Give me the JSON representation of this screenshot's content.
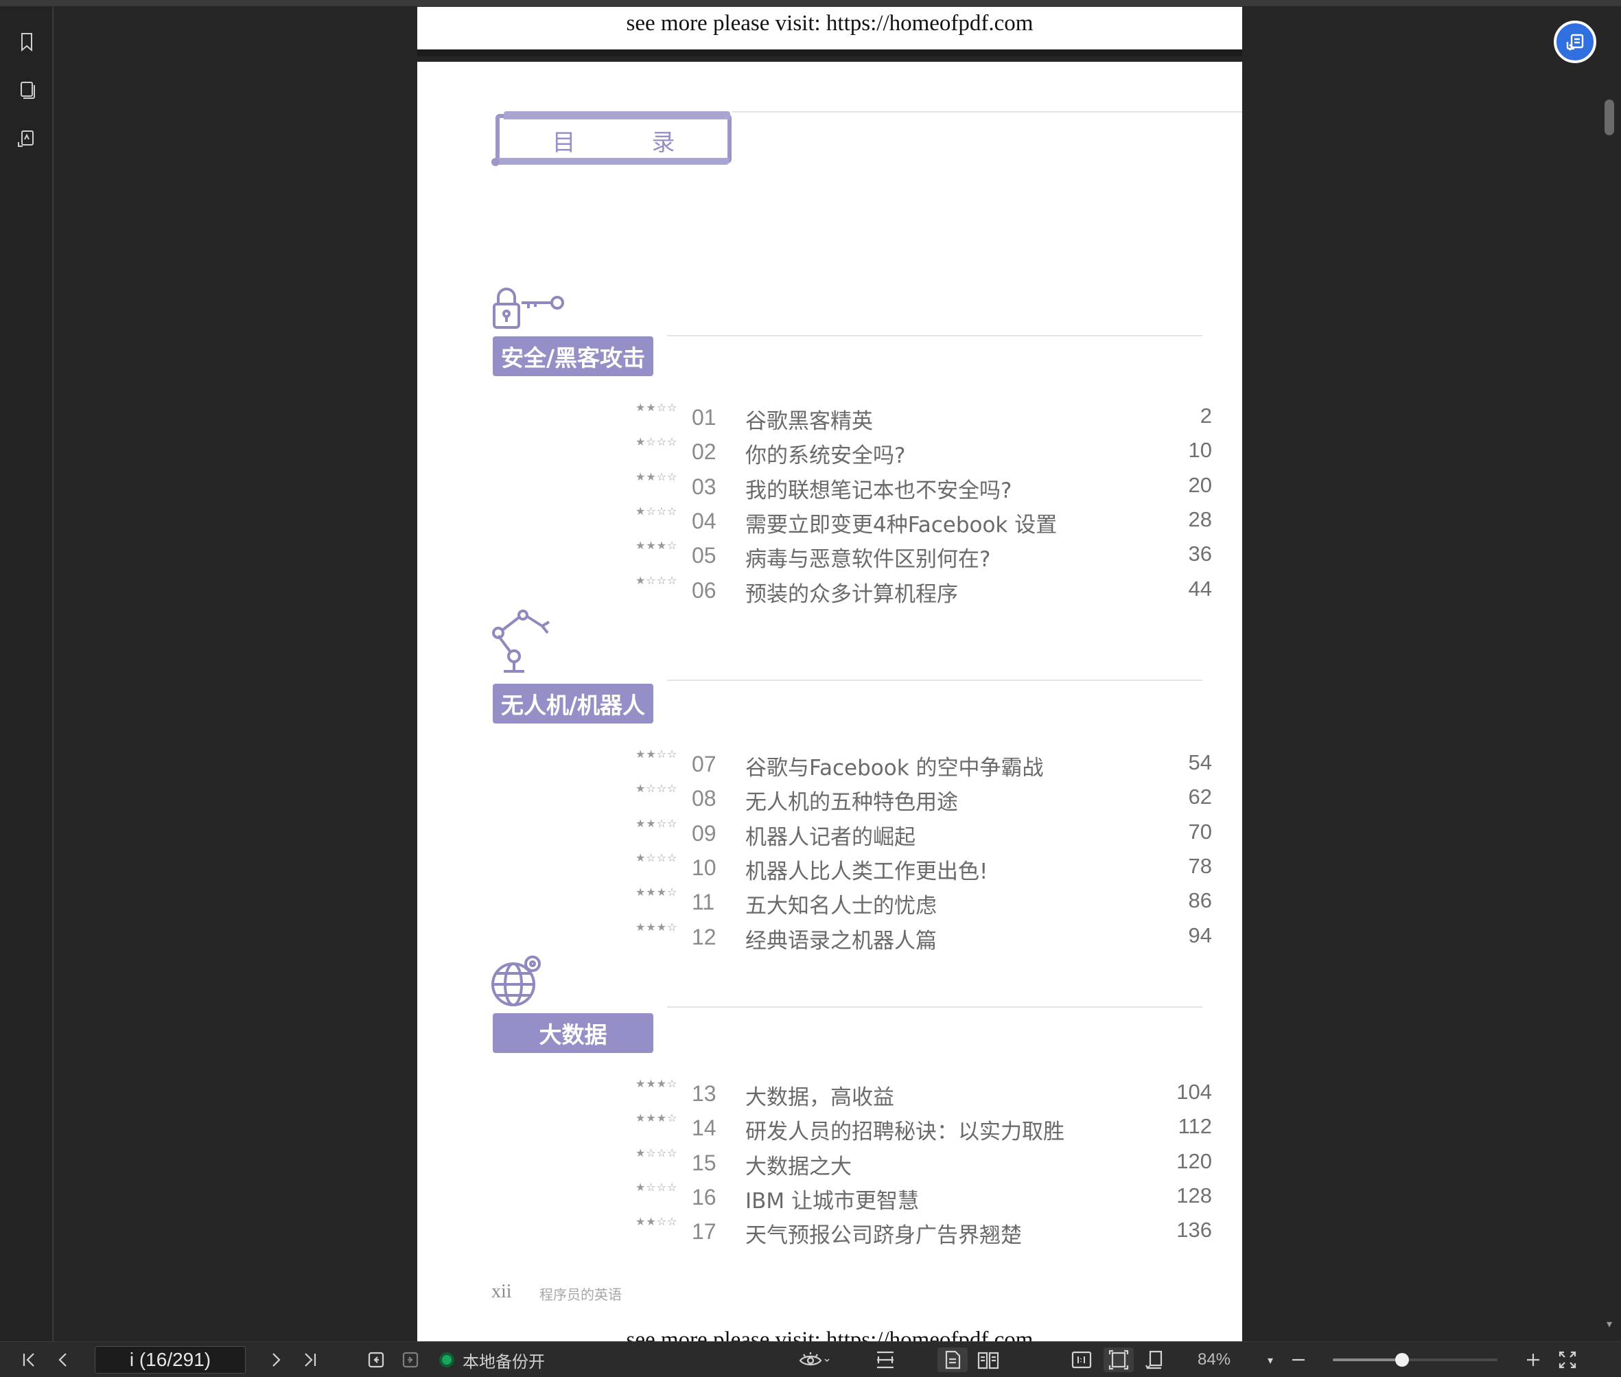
{
  "watermark": {
    "banner": "see more please visit: https://homeofpdf.com"
  },
  "toc": {
    "title": "目  录"
  },
  "sections": [
    {
      "tag": "安全/黑客攻击",
      "icon": "lock-key-icon",
      "entries": [
        {
          "stars": "★★☆☆",
          "num": "01",
          "title": "谷歌黑客精英",
          "page": "2"
        },
        {
          "stars": "★☆☆☆",
          "num": "02",
          "title": "你的系统安全吗?",
          "page": "10"
        },
        {
          "stars": "★★☆☆",
          "num": "03",
          "title": "我的联想笔记本也不安全吗?",
          "page": "20"
        },
        {
          "stars": "★☆☆☆",
          "num": "04",
          "title": "需要立即变更4种Facebook 设置",
          "page": "28"
        },
        {
          "stars": "★★★☆",
          "num": "05",
          "title": "病毒与恶意软件区别何在?",
          "page": "36"
        },
        {
          "stars": "★☆☆☆",
          "num": "06",
          "title": "预装的众多计算机程序",
          "page": "44"
        }
      ]
    },
    {
      "tag": "无人机/机器人",
      "icon": "robot-arm-icon",
      "entries": [
        {
          "stars": "★★☆☆",
          "num": "07",
          "title": "谷歌与Facebook 的空中争霸战",
          "page": "54"
        },
        {
          "stars": "★☆☆☆",
          "num": "08",
          "title": "无人机的五种特色用途",
          "page": "62"
        },
        {
          "stars": "★★☆☆",
          "num": "09",
          "title": "机器人记者的崛起",
          "page": "70"
        },
        {
          "stars": "★☆☆☆",
          "num": "10",
          "title": "机器人比人类工作更出色!",
          "page": "78"
        },
        {
          "stars": "★★★☆",
          "num": "11",
          "title": "五大知名人士的忧虑",
          "page": "86"
        },
        {
          "stars": "★★★☆",
          "num": "12",
          "title": "经典语录之机器人篇",
          "page": "94"
        }
      ]
    },
    {
      "tag": "大数据",
      "icon": "globe-pin-icon",
      "entries": [
        {
          "stars": "★★★☆",
          "num": "13",
          "title": "大数据，高收益",
          "page": "104"
        },
        {
          "stars": "★★★☆",
          "num": "14",
          "title": "研发人员的招聘秘诀：以实力取胜",
          "page": "112"
        },
        {
          "stars": "★☆☆☆",
          "num": "15",
          "title": "大数据之大",
          "page": "120"
        },
        {
          "stars": "★☆☆☆",
          "num": "16",
          "title": "IBM 让城市更智慧",
          "page": "128"
        },
        {
          "stars": "★★☆☆",
          "num": "17",
          "title": "天气预报公司跻身广告界翘楚",
          "page": "136"
        }
      ]
    }
  ],
  "footer": {
    "page_no": "xii",
    "book_title": "程序员的英语"
  },
  "toolbar": {
    "page_indicator": "i (16/291)",
    "backup_label": "本地备份开",
    "backup_color": "#1aa55a",
    "zoom_label": "84%",
    "zoom_level": 0.42
  },
  "colors": {
    "accent": "#948fc6",
    "float_button": "#2f6fe0"
  }
}
